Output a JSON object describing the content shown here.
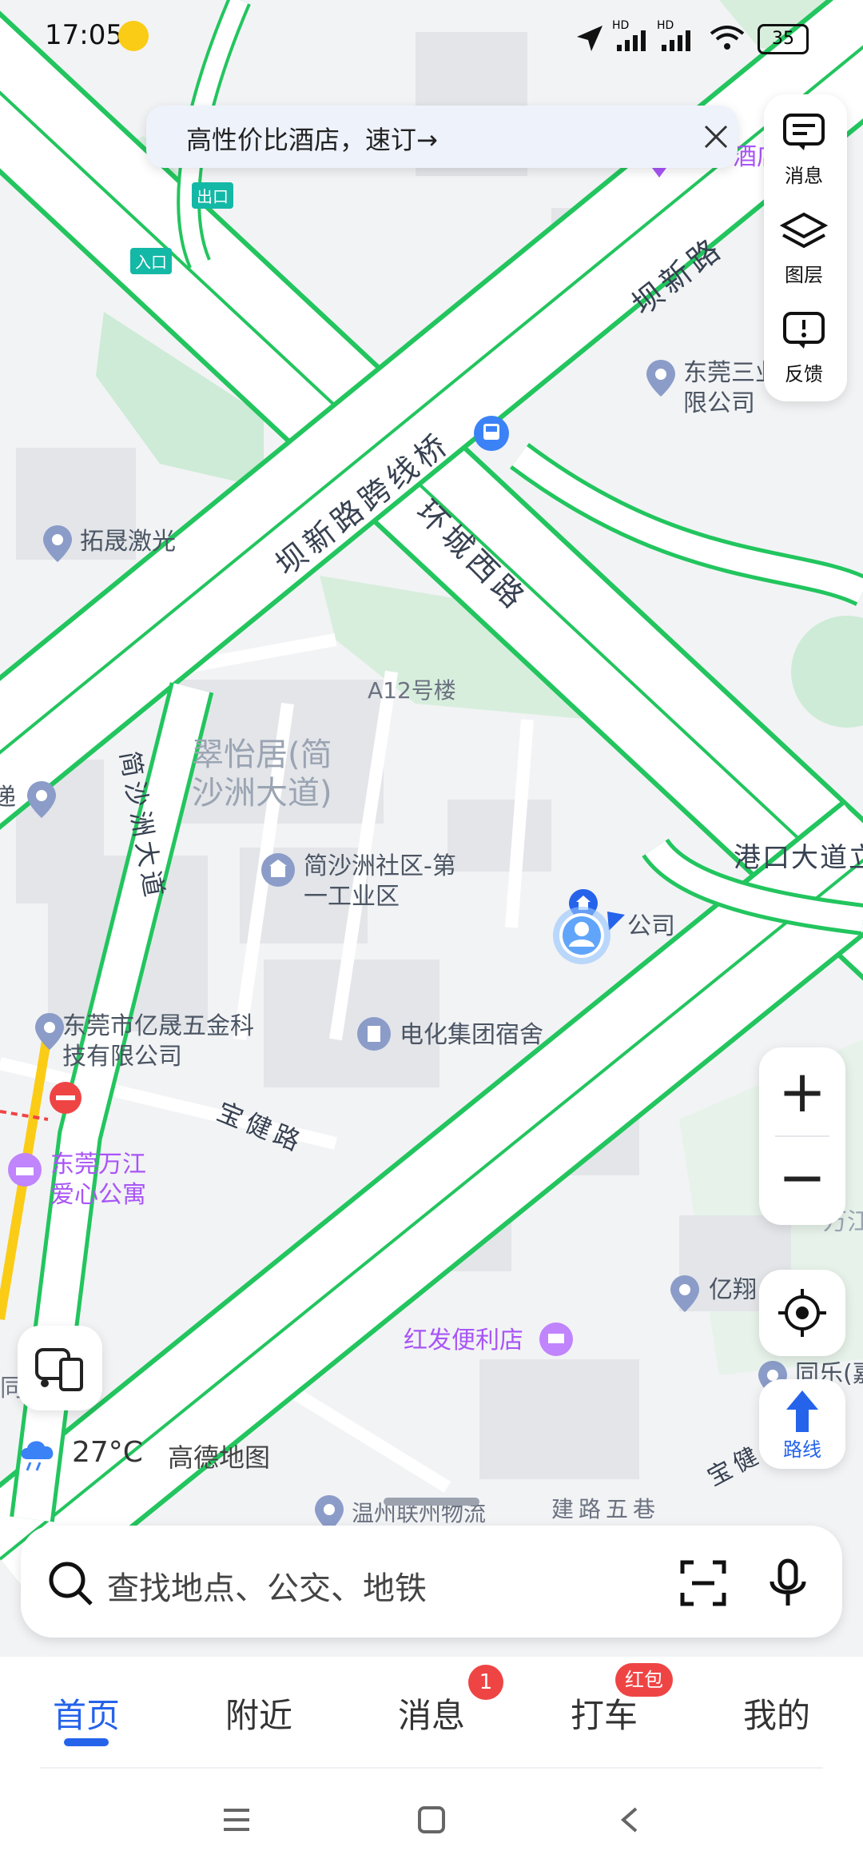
{
  "status_bar": {
    "time": "17:05",
    "battery": "35",
    "signal_labels": [
      "HD",
      "HD"
    ]
  },
  "banner": {
    "text": "高性价比酒店，速订→"
  },
  "side_panel": {
    "items": [
      {
        "label": "消息",
        "icon": "message-icon"
      },
      {
        "label": "图层",
        "icon": "layers-icon"
      },
      {
        "label": "反馈",
        "icon": "feedback-icon"
      }
    ]
  },
  "map": {
    "roads": {
      "baxin_road": "坝新路",
      "baxin_overpass": "坝新路跨线桥",
      "huancheng_west": "环城西路",
      "jianshazhou_avenue": "简沙洲大道",
      "gangkou_avenue": "港口大道立",
      "baojian_road": "宝健路",
      "baojian_er": "宝健二",
      "road_bottom": "建路五巷"
    },
    "pois": {
      "tuosheng": "拓晟激光",
      "building_a12": "A12号楼",
      "cuiyiju": "翠怡居(简沙洲大道)",
      "community": "简沙洲社区-第一工业区",
      "company": "公司",
      "yisheng": "东莞市亿晟五金科技有限公司",
      "dianhua": "电化集团宿舍",
      "wanjiang": "东莞万江爱心公寓",
      "hongfa": "红发便利店",
      "yixiang": "亿翔",
      "dongguan_san": "东莞三业有限公司",
      "hotel_partial": "酒店",
      "logistics": "温州联州物流",
      "tongle": "同乐(嘉",
      "wanjiang_right": "万江",
      "entrance": "入口",
      "exit": "出口",
      "left_edge_1": "递",
      "left_edge_2": "同"
    },
    "weather": "27°C",
    "brand": "高德地图"
  },
  "zoom": {
    "in": "+",
    "out": "−"
  },
  "route_button": {
    "label": "路线"
  },
  "search": {
    "placeholder": "查找地点、公交、地铁"
  },
  "tabs": [
    {
      "label": "首页",
      "active": true
    },
    {
      "label": "附近"
    },
    {
      "label": "消息",
      "badge": "1"
    },
    {
      "label": "打车",
      "badge": "红包"
    },
    {
      "label": "我的"
    }
  ],
  "colors": {
    "accent": "#2563eb",
    "road_outline": "#22c55e",
    "badge": "#ef4444"
  }
}
